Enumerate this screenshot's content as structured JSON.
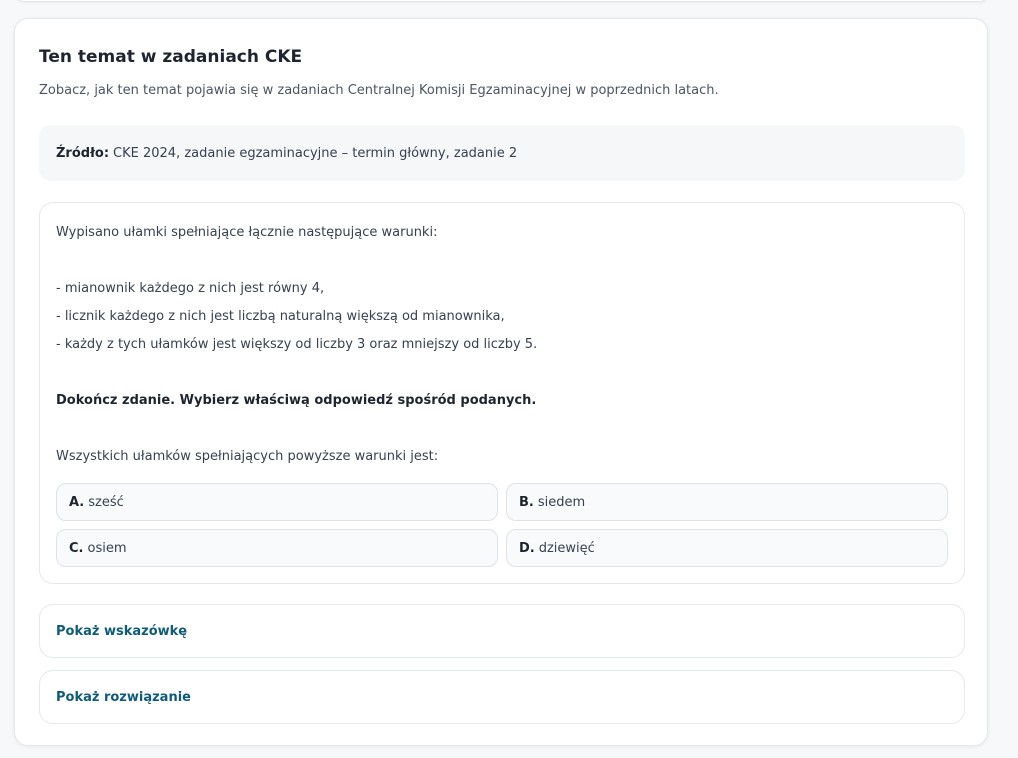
{
  "section": {
    "title": "Ten temat w zadaniach CKE",
    "subtitle": "Zobacz, jak ten temat pojawia się w zadaniach Centralnej Komisji Egzaminacyjnej w poprzednich latach."
  },
  "source": {
    "label": "Źródło:",
    "value": "CKE 2024, zadanie egzaminacyjne – termin główny, zadanie 2"
  },
  "task": {
    "intro": "Wypisano ułamki spełniające łącznie następujące warunki:",
    "conditions": [
      "- mianownik każdego z nich jest równy 4,",
      "- licznik każdego z nich jest liczbą naturalną większą od mianownika,",
      "- każdy z tych ułamków jest większy od liczby 3 oraz mniejszy od liczby 5."
    ],
    "instruction": "Dokończ zdanie. Wybierz właściwą odpowiedź spośród podanych.",
    "question": "Wszystkich ułamków spełniających powyższe warunki jest:",
    "options": [
      {
        "letter": "A.",
        "text": "sześć"
      },
      {
        "letter": "B.",
        "text": "siedem"
      },
      {
        "letter": "C.",
        "text": "osiem"
      },
      {
        "letter": "D.",
        "text": "dziewięć"
      }
    ]
  },
  "toggles": {
    "hint": "Pokaż wskazówkę",
    "solution": "Pokaż rozwiązanie"
  }
}
